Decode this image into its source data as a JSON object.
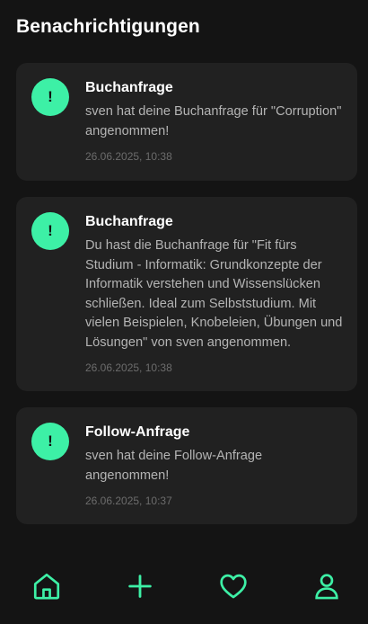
{
  "header": {
    "title": "Benachrichtigungen"
  },
  "notifications": [
    {
      "icon": "exclamation-icon",
      "title": "Buchanfrage",
      "body": "sven hat deine Buchanfrage für \"Corruption\" angenommen!",
      "time": "26.06.2025, 10:38"
    },
    {
      "icon": "exclamation-icon",
      "title": "Buchanfrage",
      "body": "Du hast die Buchanfrage für \"Fit fürs Studium - Informatik: Grundkonzepte der Informatik verstehen und Wissenslücken schließen. Ideal zum Selbststudium. Mit vielen Beispielen, Knobeleien, Übungen und Lösungen\" von sven angenommen.",
      "time": "26.06.2025, 10:38"
    },
    {
      "icon": "exclamation-icon",
      "title": "Follow-Anfrage",
      "body": "sven hat deine Follow-Anfrage angenommen!",
      "time": "26.06.2025, 10:37"
    }
  ],
  "badge_symbol": "!",
  "nav": {
    "items": [
      {
        "icon": "home-icon"
      },
      {
        "icon": "plus-icon"
      },
      {
        "icon": "heart-icon"
      },
      {
        "icon": "user-icon"
      }
    ]
  },
  "colors": {
    "background": "#141414",
    "card": "#212121",
    "accent": "#3df0a6",
    "title_text": "#ffffff",
    "body_text": "#b4b4b4",
    "time_text": "#6c6c6c"
  }
}
